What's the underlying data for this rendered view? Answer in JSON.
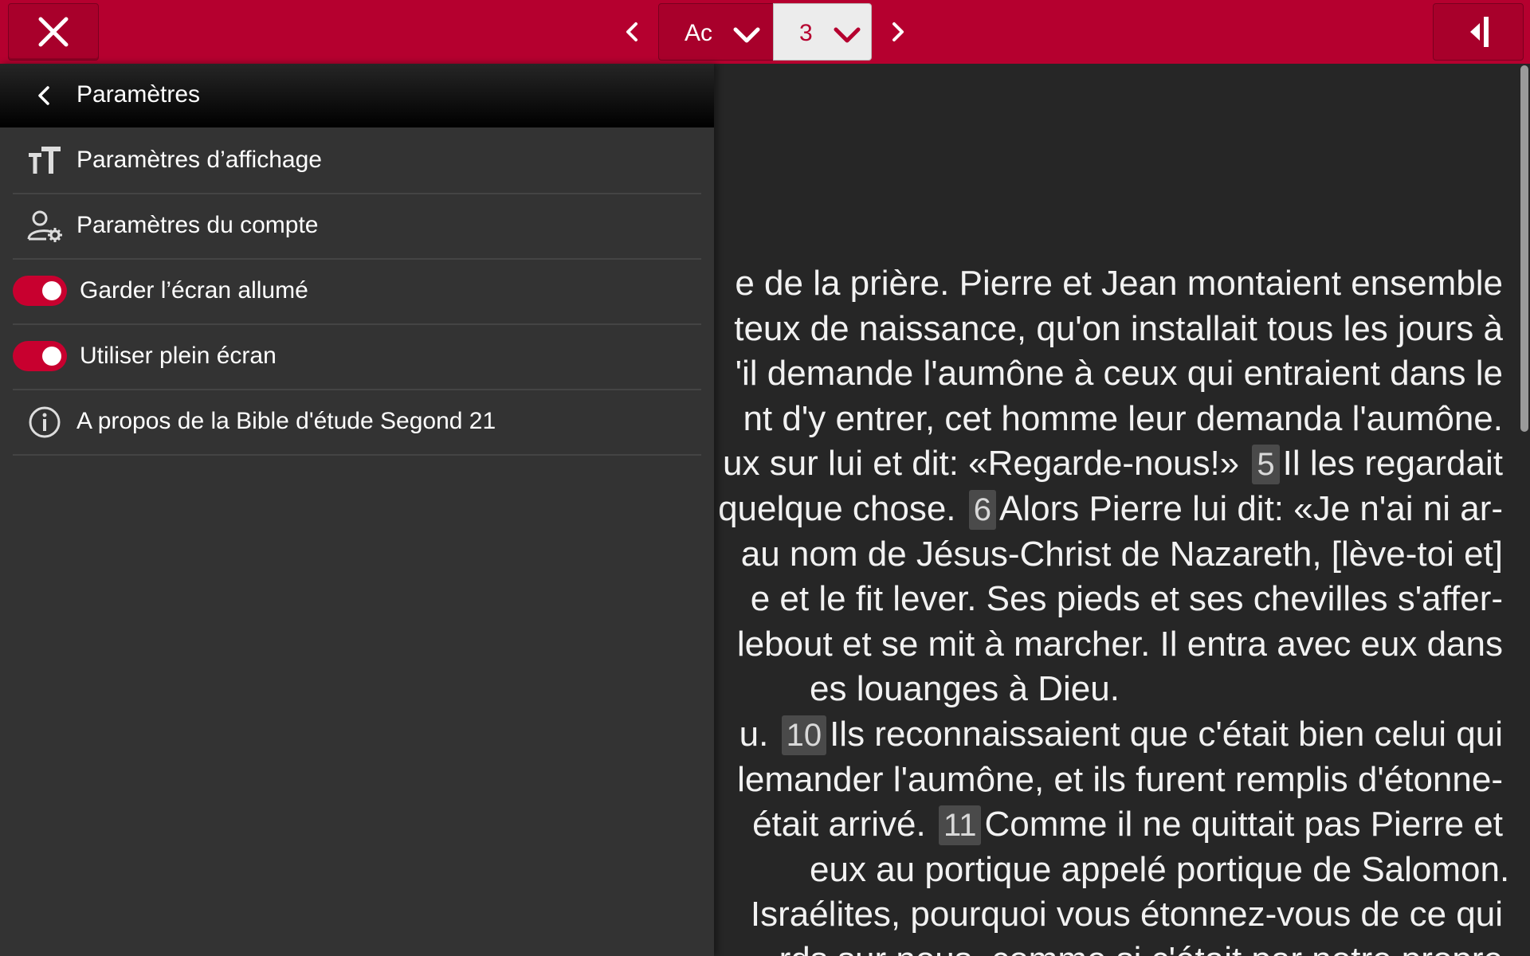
{
  "colors": {
    "accent": "#b5002f",
    "drawer_background": "#333333",
    "reader_background": "#262626",
    "toggle_on": "#c8002f"
  },
  "toolbar": {
    "close_icon": "close-icon",
    "prev_icon": "chevron-left-icon",
    "book_label": "Ac",
    "chapter_label": "3",
    "next_icon": "chevron-right-icon",
    "panel_icon": "collapse-panel-icon"
  },
  "drawer": {
    "title": "Paramètres",
    "items": [
      {
        "label": "Paramètres d’affichage",
        "icon": "text-size-icon"
      },
      {
        "label": "Paramètres du compte",
        "icon": "user-settings-icon"
      },
      {
        "label": "Garder l’écran allumé",
        "toggle": true
      },
      {
        "label": "Utiliser plein écran",
        "toggle": true
      },
      {
        "label": "A propos de la Bible d'étude Segond 21",
        "icon": "info-icon"
      }
    ]
  },
  "reader": {
    "lines": [
      {
        "text": "e de la prière. Pierre et Jean montaient ensemble"
      },
      {
        "text": "teux de naissance, qu'on installait tous les jours à"
      },
      {
        "text": "'il demande l'aumône à ceux qui entraient dans le"
      },
      {
        "text": "nt d'y entrer, cet homme leur demanda l'aumône."
      },
      {
        "text": "ux sur lui et dit: «Regarde-nous!»",
        "verse": "5",
        "after": "Il les regardait"
      },
      {
        "text": "quelque chose.",
        "verse": "6",
        "after": "Alors Pierre lui dit: «Je n'ai ni ar-"
      },
      {
        "text": "au nom de Jésus-Christ de Nazareth, [lève-toi et]"
      },
      {
        "text": "e et le fit lever. Ses pieds et ses chevilles s'affer-"
      },
      {
        "text": "lebout et se mit à marcher. Il entra avec eux dans"
      },
      {
        "text": "es louanges à Dieu.",
        "start": true
      },
      {
        "text": "u.",
        "verse": "10",
        "after": "Ils reconnaissaient que c'était bien celui qui"
      },
      {
        "text": "lemander l'aumône, et ils furent remplis d'étonne-"
      },
      {
        "text": "était arrivé.",
        "verse": "11",
        "after": "Comme il ne quittait pas Pierre et"
      },
      {
        "text": "eux au portique appelé portique de Salomon.",
        "start": true
      },
      {
        "text": "Israélites, pourquoi vous étonnez-vous de ce qui"
      },
      {
        "text": "rds sur nous, comme si c'était par notre propre"
      }
    ]
  }
}
